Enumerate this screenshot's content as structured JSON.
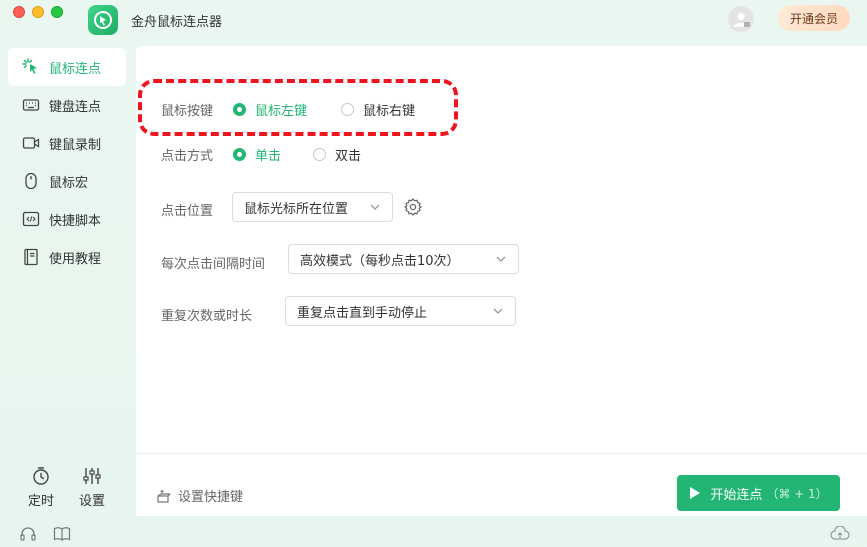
{
  "app": {
    "title": "金舟鼠标连点器",
    "vip_label": "开通会员"
  },
  "colors": {
    "accent": "#22b573",
    "highlight_border": "#f0141e",
    "vip_bg": "#ffe1cc"
  },
  "sidebar": {
    "items": [
      {
        "label": "鼠标连点",
        "icon": "mouse-click-icon",
        "active": true
      },
      {
        "label": "键盘连点",
        "icon": "keyboard-icon",
        "active": false
      },
      {
        "label": "键鼠录制",
        "icon": "record-icon",
        "active": false
      },
      {
        "label": "鼠标宏",
        "icon": "mouse-icon",
        "active": false
      },
      {
        "label": "快捷脚本",
        "icon": "code-icon",
        "active": false
      },
      {
        "label": "使用教程",
        "icon": "book-icon",
        "active": false
      }
    ],
    "bottom": {
      "timer_label": "定时",
      "settings_label": "设置"
    }
  },
  "form": {
    "mouse_button": {
      "label": "鼠标按键",
      "options": [
        "鼠标左键",
        "鼠标右键"
      ],
      "selected": "鼠标左键"
    },
    "click_mode": {
      "label": "点击方式",
      "options": [
        "单击",
        "双击"
      ],
      "selected": "单击"
    },
    "click_position": {
      "label": "点击位置",
      "value": "鼠标光标所在位置"
    },
    "interval": {
      "label": "每次点击间隔时间",
      "value": "高效模式（每秒点击10次）"
    },
    "repeat": {
      "label": "重复次数或时长",
      "value": "重复点击直到手动停止"
    }
  },
  "footer": {
    "shortcut_label": "设置快捷键",
    "start_label": "开始连点",
    "start_shortcut": "（⌘ + 1）"
  }
}
